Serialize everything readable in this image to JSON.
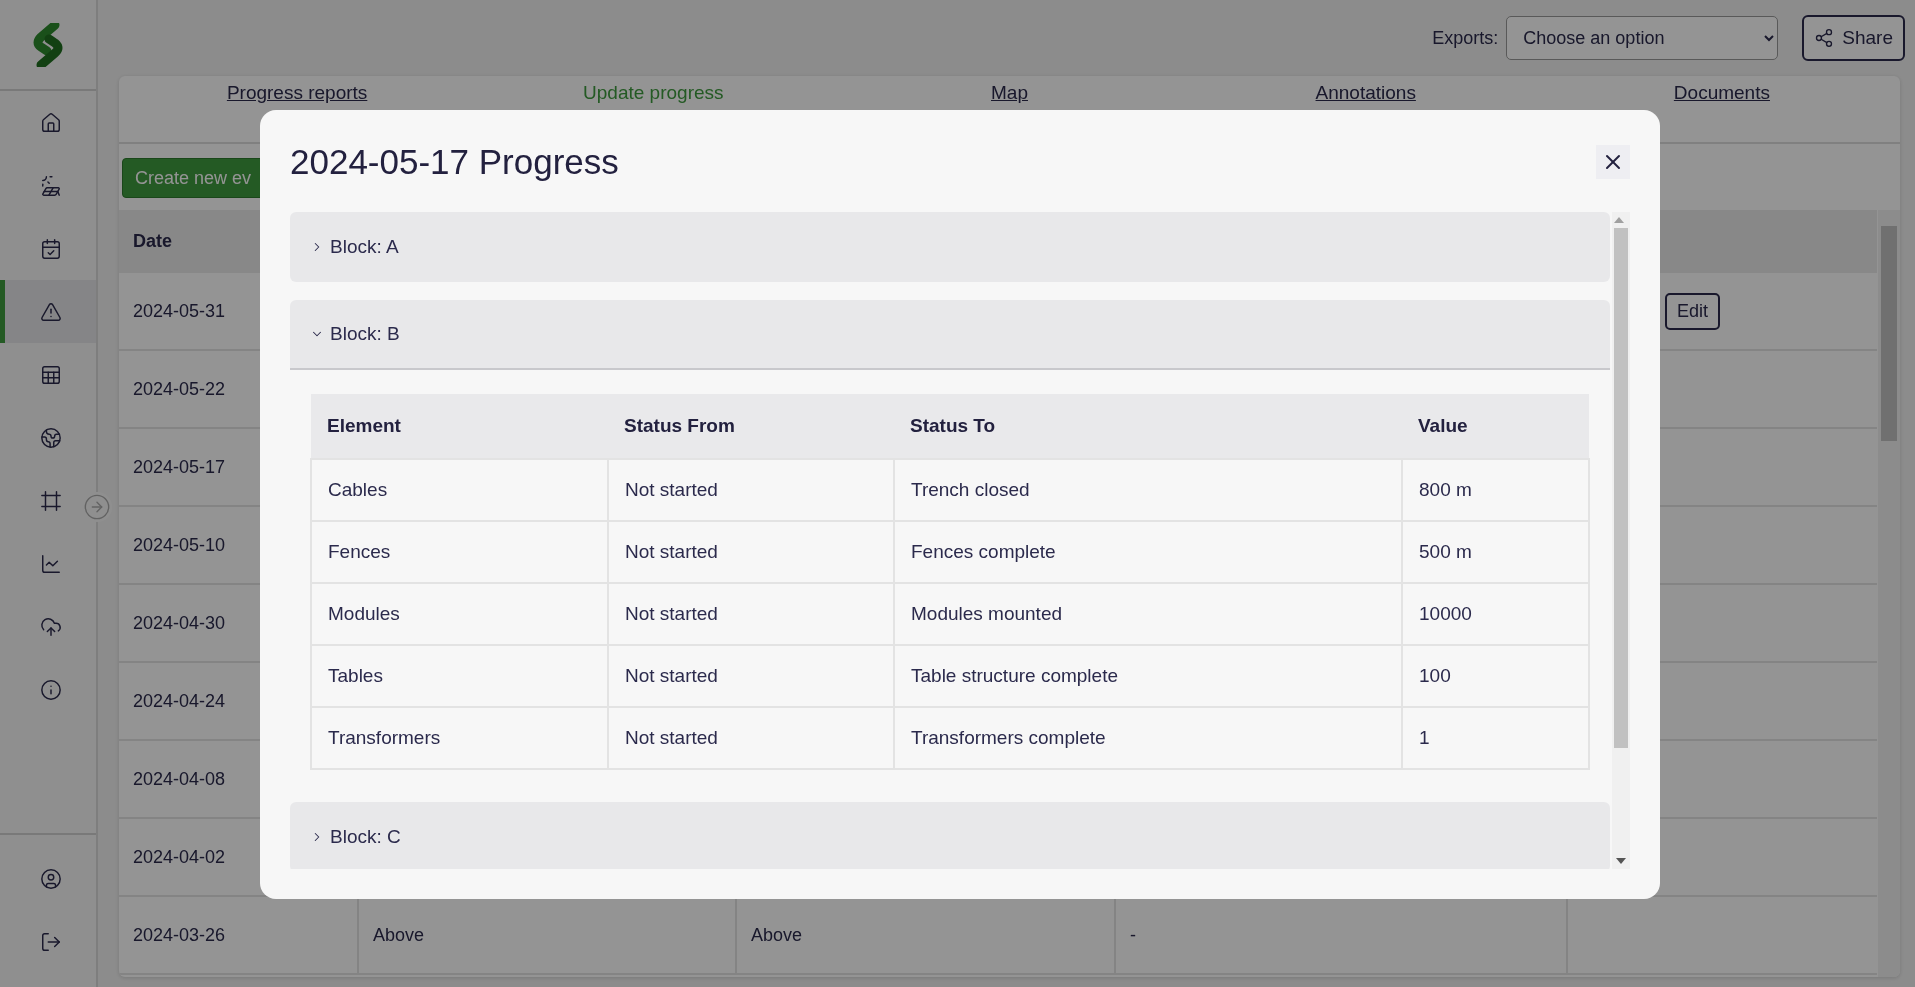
{
  "sidebar": {
    "items": [
      {
        "selected": false
      },
      {
        "selected": false
      },
      {
        "selected": false
      },
      {
        "selected": true
      },
      {
        "selected": false
      },
      {
        "selected": false
      },
      {
        "selected": false
      },
      {
        "selected": false
      },
      {
        "selected": false
      },
      {
        "selected": false
      }
    ],
    "bottom_items": [
      {
        "selected": false
      },
      {
        "selected": false
      }
    ]
  },
  "header": {
    "exports_label": "Exports:",
    "exports_select": {
      "value": "Choose an option"
    },
    "share_button": "Share"
  },
  "tabs": [
    {
      "label": "Progress reports",
      "selected": false
    },
    {
      "label": "Update progress",
      "selected": true
    },
    {
      "label": "Map",
      "selected": false
    },
    {
      "label": "Annotations",
      "selected": false
    },
    {
      "label": "Documents",
      "selected": false
    }
  ],
  "create_button": "Create new ev",
  "table": {
    "columns": [
      "Date"
    ],
    "rows": [
      {
        "date": "2024-05-31",
        "action": "Edit"
      },
      {
        "date": "2024-05-22"
      },
      {
        "date": "2024-05-17"
      },
      {
        "date": "2024-05-10"
      },
      {
        "date": "2024-04-30"
      },
      {
        "date": "2024-04-24"
      },
      {
        "date": "2024-04-08"
      },
      {
        "date": "2024-04-02"
      },
      {
        "date": "2024-03-26",
        "cells": [
          "Above",
          "Above",
          "-"
        ]
      }
    ]
  },
  "modal": {
    "title": "2024-05-17 Progress",
    "blocks": [
      {
        "label": "Block: A",
        "expanded": false
      },
      {
        "label": "Block: B",
        "expanded": true,
        "table": {
          "columns": [
            "Element",
            "Status From",
            "Status To",
            "Value"
          ],
          "rows": [
            [
              "Cables",
              "Not started",
              "Trench closed",
              "800 m"
            ],
            [
              "Fences",
              "Not started",
              "Fences complete",
              "500 m"
            ],
            [
              "Modules",
              "Not started",
              "Modules mounted",
              "10000"
            ],
            [
              "Tables",
              "Not started",
              "Table structure complete",
              "100"
            ],
            [
              "Transformers",
              "Not started",
              "Transformers complete",
              "1"
            ]
          ]
        }
      },
      {
        "label": "Block: C",
        "expanded": false
      }
    ]
  }
}
